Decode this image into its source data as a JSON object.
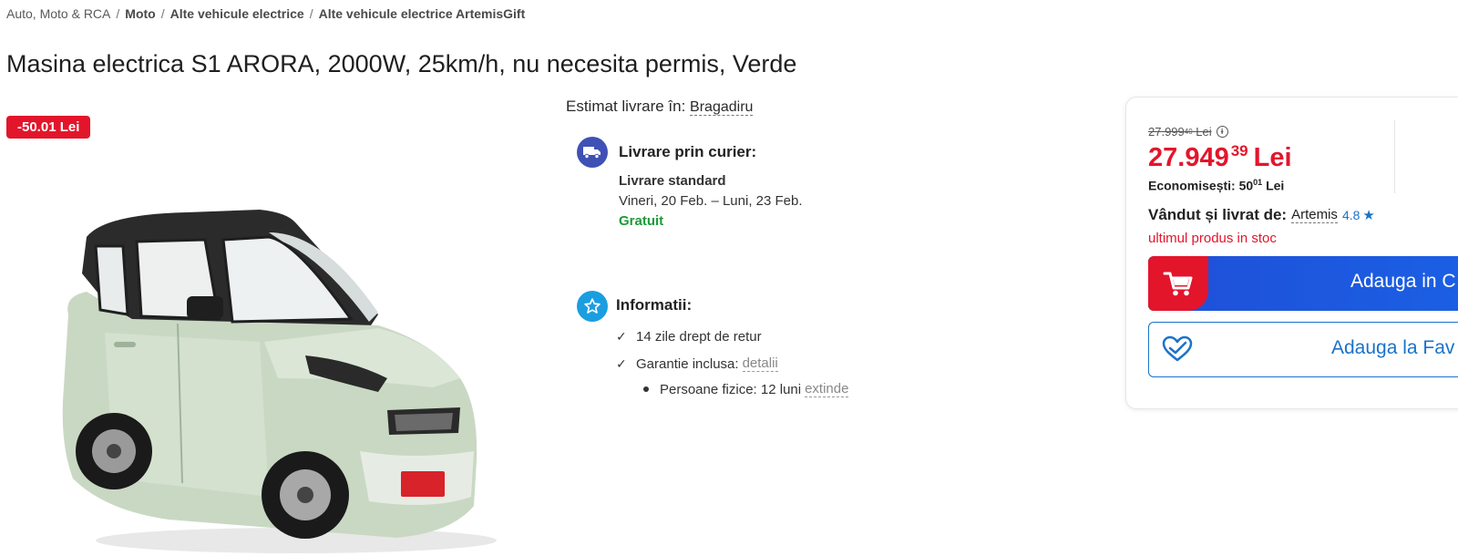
{
  "breadcrumb": {
    "items": [
      "Auto, Moto & RCA",
      "Moto",
      "Alte vehicule electrice",
      "Alte vehicule electrice ArtemisGift"
    ],
    "separator": "/"
  },
  "product": {
    "title": "Masina electrica S1 ARORA, 2000W, 25km/h, nu necesita permis, Verde",
    "discount_badge": "-50.01 Lei",
    "image_icon": "car-product-image"
  },
  "delivery": {
    "estimate_label": "Estimat livrare în:",
    "location": "Bragadiru",
    "courier_heading": "Livrare prin curier:",
    "standard_title": "Livrare standard",
    "standard_dates": "Vineri, 20 Feb. – Luni, 23 Feb.",
    "standard_price": "Gratuit",
    "icon": "truck-icon"
  },
  "info": {
    "heading": "Informatii:",
    "icon": "star-icon",
    "return_policy": "14 zile drept de retur",
    "warranty_label": "Garantie inclusa:",
    "warranty_link": "detalii",
    "persons_label": "Persoane fizice: 12 luni",
    "persons_link": "extinde"
  },
  "pricing": {
    "old_price_int": "27.999",
    "old_price_dec": "40",
    "old_price_currency": "Lei",
    "new_price_int": "27.949",
    "new_price_dec": "39",
    "new_price_currency": "Lei",
    "savings_label": "Economisești:",
    "savings_int": "50",
    "savings_dec": "01",
    "savings_currency": "Lei",
    "price_color": "#e3152b"
  },
  "seller": {
    "label": "Vândut și livrat de:",
    "name": "Artemis",
    "rating": "4.8",
    "stock_status": "ultimul produs in stoc"
  },
  "actions": {
    "cart_label": "Adauga in C",
    "favorites_label": "Adauga la Fav",
    "cart_color": "#1f4fd8",
    "cart_icon_bg": "#e3152b"
  }
}
